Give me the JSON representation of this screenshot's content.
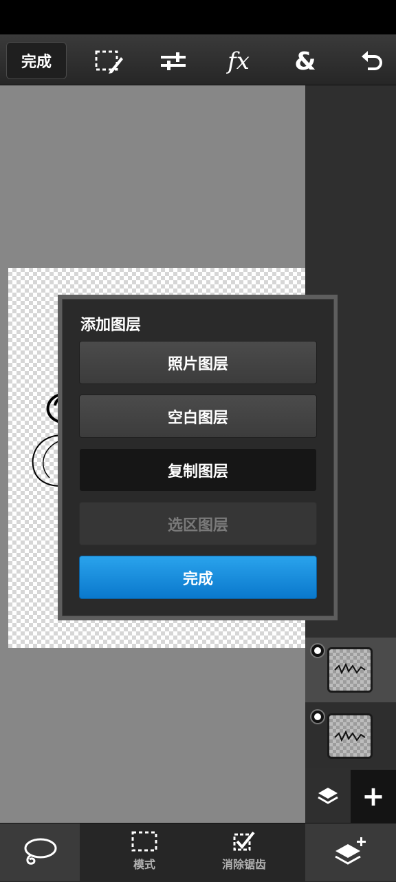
{
  "toolbar": {
    "done_label": "完成",
    "tools": [
      "selection-edit-icon",
      "adjust-sliders-icon",
      "fx-icon",
      "ampersand-icon",
      "undo-icon"
    ],
    "fx_label": "fx",
    "ampersand_label": "&"
  },
  "dialog": {
    "title": "添加图层",
    "buttons": [
      {
        "label": "照片图层",
        "state": "normal"
      },
      {
        "label": "空白图层",
        "state": "normal"
      },
      {
        "label": "复制图层",
        "state": "pressed"
      },
      {
        "label": "选区图层",
        "state": "disabled"
      }
    ],
    "done_label": "完成"
  },
  "layers_panel": {
    "layers": [
      {
        "selected": true
      },
      {
        "selected": false
      }
    ],
    "add_label": "+"
  },
  "bottom_bar": {
    "tools": [
      {
        "icon": "lasso-icon",
        "label": ""
      },
      {
        "icon": "marquee-icon",
        "label": "模式"
      },
      {
        "icon": "antialias-icon",
        "label": "消除锯齿"
      }
    ]
  },
  "colors": {
    "accent": "#1a8fe0",
    "canvas_bg": "#878787",
    "panel_bg": "#2f2f2f"
  }
}
